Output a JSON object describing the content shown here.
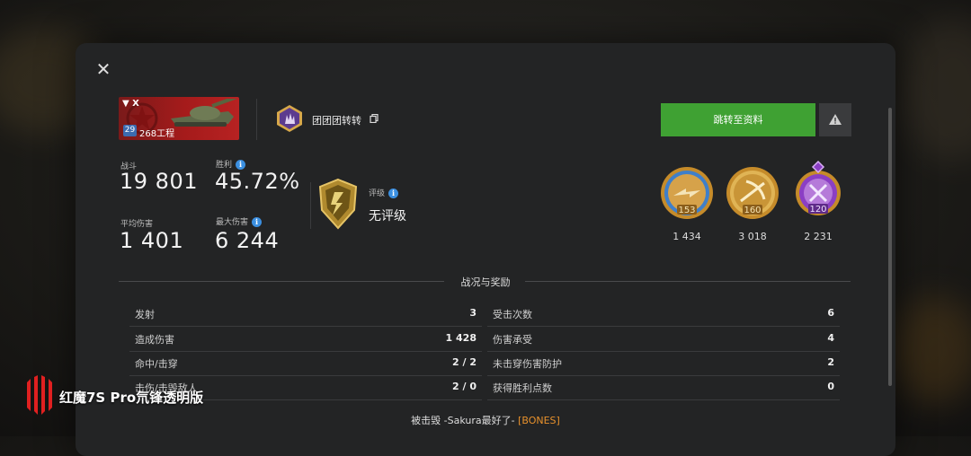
{
  "dialog": {
    "close_label": "✕",
    "tank": {
      "tier_mark": "▼ X",
      "level": "29",
      "name": "268工程"
    },
    "player": {
      "name": "团团团转转"
    },
    "go_profile_label": "跳转至资料",
    "stats": {
      "battles_label": "战斗",
      "battles_value": "19 801",
      "winrate_label": "胜利",
      "winrate_value": "45.72%",
      "avg_damage_label": "平均伤害",
      "avg_damage_value": "1 401",
      "max_damage_label": "最大伤害",
      "max_damage_value": "6 244"
    },
    "rating": {
      "label": "评级",
      "value": "无评级"
    },
    "medals": [
      {
        "level": "153",
        "count": "1 434",
        "icon": "winged-shell-medal-icon"
      },
      {
        "level": "160",
        "count": "3 018",
        "icon": "crossbow-medal-icon"
      },
      {
        "level": "120",
        "count": "2 231",
        "icon": "crossed-swords-medal-icon"
      }
    ],
    "section_title": "战况与奖励",
    "left_rows": [
      {
        "label": "发射",
        "value": "3"
      },
      {
        "label": "造成伤害",
        "value": "1 428"
      },
      {
        "label": "命中/击穿",
        "value": "2 / 2"
      },
      {
        "label": "击伤/击毁敌人",
        "value": "2 / 0"
      }
    ],
    "right_rows": [
      {
        "label": "受击次数",
        "value": "6"
      },
      {
        "label": "伤害承受",
        "value": "4"
      },
      {
        "label": "未击穿伤害防护",
        "value": "2"
      },
      {
        "label": "获得胜利点数",
        "value": "0"
      }
    ],
    "killed_by": {
      "prefix": "被击毁",
      "player": "-Sakura最好了-",
      "clan": "[BONES]"
    },
    "colors": {
      "accent_green": "#3fa133",
      "info_blue": "#3b8fe0",
      "clan_orange": "#e8912c"
    }
  },
  "watermark": {
    "text": "红魔7S Pro氘锋透明版"
  }
}
